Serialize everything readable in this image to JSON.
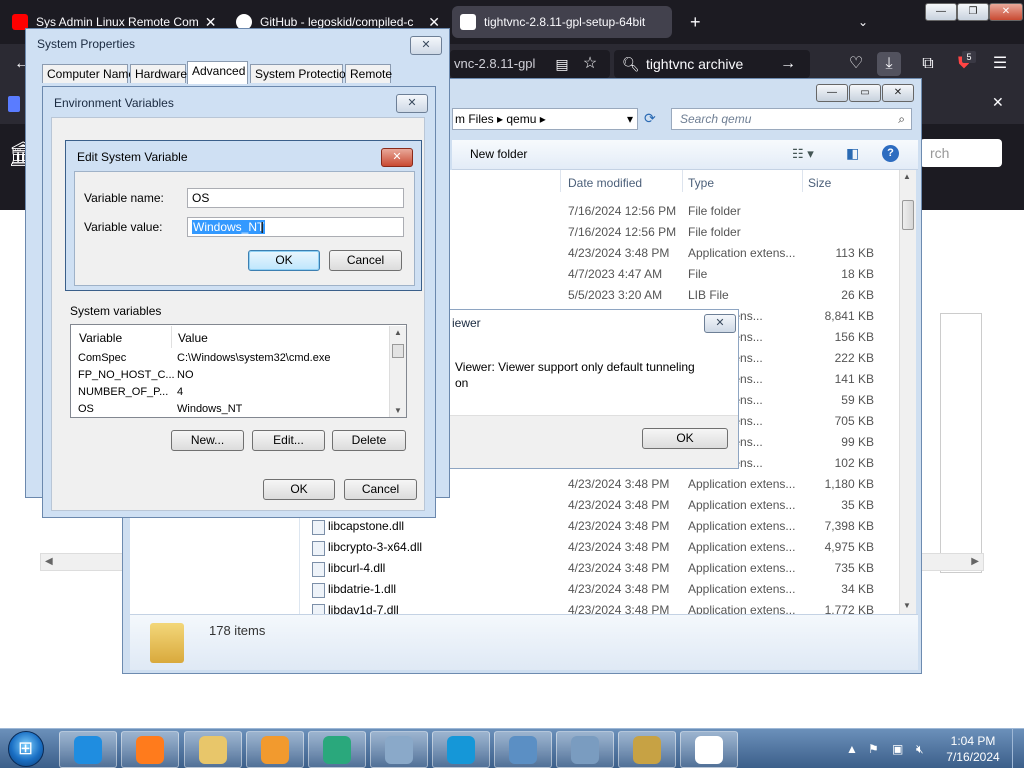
{
  "browser": {
    "tabs": [
      {
        "title": "Sys Admin Linux Remote Com",
        "favicon_color": "#ff0000"
      },
      {
        "title": "GitHub - legoskid/compiled-c",
        "favicon_color": "#ffffff"
      },
      {
        "title": "tightvnc-2.8.11-gpl-setup-64bit",
        "favicon_color": "#ffffff"
      }
    ],
    "new_tab_icon": "plus-icon",
    "url_fragment": "vnc-2.8.11-gpl",
    "search_query": "tightvnc archive",
    "badge_count": "5",
    "site_search_placeholder": "rch"
  },
  "explorer": {
    "breadcrumb": [
      "m Files",
      "qemu"
    ],
    "search_placeholder": "Search qemu",
    "new_folder": "New folder",
    "columns": {
      "date": "Date modified",
      "type": "Type",
      "size": "Size"
    },
    "rows": [
      {
        "name": "",
        "date": "7/16/2024 12:56 PM",
        "type": "File folder",
        "size": ""
      },
      {
        "name": "",
        "date": "7/16/2024 12:56 PM",
        "type": "File folder",
        "size": ""
      },
      {
        "name": "",
        "date": "4/23/2024 3:48 PM",
        "type": "Application extens...",
        "size": "113 KB"
      },
      {
        "name": "",
        "date": "4/7/2023 4:47 AM",
        "type": "File",
        "size": "18 KB"
      },
      {
        "name": "",
        "date": "5/5/2023 3:20 AM",
        "type": "LIB File",
        "size": "26 KB"
      },
      {
        "name": "",
        "date": "",
        "type": "ation extens...",
        "size": "8,841 KB"
      },
      {
        "name": "",
        "date": "",
        "type": "ation extens...",
        "size": "156 KB"
      },
      {
        "name": "",
        "date": "",
        "type": "ation extens...",
        "size": "222 KB"
      },
      {
        "name": "",
        "date": "",
        "type": "ation extens...",
        "size": "141 KB"
      },
      {
        "name": "",
        "date": "",
        "type": "ation extens...",
        "size": "59 KB"
      },
      {
        "name": "",
        "date": "",
        "type": "ation extens...",
        "size": "705 KB"
      },
      {
        "name": "",
        "date": "",
        "type": "ation extens...",
        "size": "99 KB"
      },
      {
        "name": "",
        "date": "",
        "type": "ation extens...",
        "size": "102 KB"
      },
      {
        "name": "",
        "date": "4/23/2024 3:48 PM",
        "type": "Application extens...",
        "size": "1,180 KB"
      },
      {
        "name": "ll",
        "date": "4/23/2024 3:48 PM",
        "type": "Application extens...",
        "size": "35 KB"
      },
      {
        "name": "libcapstone.dll",
        "date": "4/23/2024 3:48 PM",
        "type": "Application extens...",
        "size": "7,398 KB"
      },
      {
        "name": "libcrypto-3-x64.dll",
        "date": "4/23/2024 3:48 PM",
        "type": "Application extens...",
        "size": "4,975 KB"
      },
      {
        "name": "libcurl-4.dll",
        "date": "4/23/2024 3:48 PM",
        "type": "Application extens...",
        "size": "735 KB"
      },
      {
        "name": "libdatrie-1.dll",
        "date": "4/23/2024 3:48 PM",
        "type": "Application extens...",
        "size": "34 KB"
      },
      {
        "name": "libdav1d-7.dll",
        "date": "4/23/2024 3:48 PM",
        "type": "Application extens...",
        "size": "1,772 KB"
      }
    ],
    "item_count": "178 items"
  },
  "vnc_dialog": {
    "title": "iewer",
    "message_line1": "Viewer: Viewer support only default tunneling",
    "message_line2": "on",
    "ok": "OK"
  },
  "system_properties": {
    "title": "System Properties",
    "tabs": [
      "Computer Name",
      "Hardware",
      "Advanced",
      "System Protection",
      "Remote"
    ],
    "active_tab": "Advanced",
    "close": "✕"
  },
  "environment_variables": {
    "title": "Environment Variables",
    "system_variables_label": "System variables",
    "list_headers": {
      "variable": "Variable",
      "value": "Value"
    },
    "system_variables": [
      {
        "variable": "ComSpec",
        "value": "C:\\Windows\\system32\\cmd.exe"
      },
      {
        "variable": "FP_NO_HOST_C...",
        "value": "NO"
      },
      {
        "variable": "NUMBER_OF_P...",
        "value": "4"
      },
      {
        "variable": "OS",
        "value": "Windows_NT"
      }
    ],
    "buttons": {
      "new": "New...",
      "edit": "Edit...",
      "delete": "Delete",
      "ok": "OK",
      "cancel": "Cancel"
    }
  },
  "edit_system_variable": {
    "title": "Edit System Variable",
    "name_label": "Variable name:",
    "name_value": "OS",
    "value_label": "Variable value:",
    "value_value": "Windows_NT",
    "ok": "OK",
    "cancel": "Cancel"
  },
  "taskbar": {
    "time": "1:04 PM",
    "date": "7/16/2024",
    "apps": [
      {
        "name": "internet-explorer-icon",
        "color": "#1f8de0"
      },
      {
        "name": "firefox-icon",
        "color": "#ff7b1c"
      },
      {
        "name": "file-explorer-icon",
        "color": "#e8c66a"
      },
      {
        "name": "media-player-icon",
        "color": "#f29a2e"
      },
      {
        "name": "vpn-globe-icon",
        "color": "#2aa87c"
      },
      {
        "name": "control-panel-icon",
        "color": "#8aa9c9"
      },
      {
        "name": "edge-icon",
        "color": "#1597d8"
      },
      {
        "name": "network-settings-icon",
        "color": "#5b8fc4"
      },
      {
        "name": "computer-icon",
        "color": "#7a9cc0"
      },
      {
        "name": "remote-desktop-icon",
        "color": "#c7a244"
      },
      {
        "name": "vnc-icon",
        "color": "#ffffff"
      }
    ]
  }
}
